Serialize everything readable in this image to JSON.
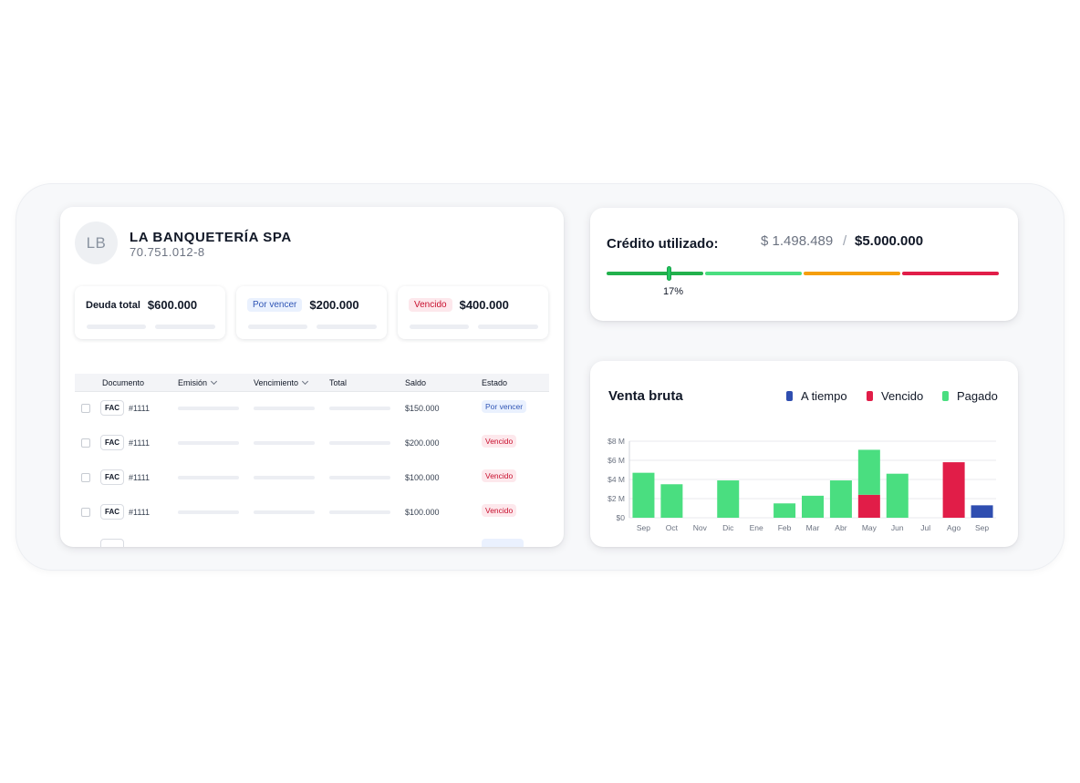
{
  "company": {
    "initials": "LB",
    "name": "LA BANQUETERÍA SPA",
    "rut": "70.751.012-8"
  },
  "stats": [
    {
      "label": "Deuda total",
      "value": "$600.000",
      "style": "plain"
    },
    {
      "label": "Por vencer",
      "value": "$200.000",
      "style": "blue"
    },
    {
      "label": "Vencido",
      "value": "$400.000",
      "style": "red"
    }
  ],
  "table": {
    "columns": [
      "Documento",
      "Emisión",
      "Vencimiento",
      "Total",
      "Saldo",
      "Estado"
    ],
    "rows": [
      {
        "type": "FAC",
        "number": "#1111",
        "saldo": "$150.000",
        "estado": "Por vencer",
        "estado_style": "blue"
      },
      {
        "type": "FAC",
        "number": "#1111",
        "saldo": "$200.000",
        "estado": "Vencido",
        "estado_style": "red"
      },
      {
        "type": "FAC",
        "number": "#1111",
        "saldo": "$100.000",
        "estado": "Vencido",
        "estado_style": "red"
      },
      {
        "type": "FAC",
        "number": "#1111",
        "saldo": "$100.000",
        "estado": "Vencido",
        "estado_style": "red"
      }
    ]
  },
  "credit": {
    "title": "Crédito utilizado:",
    "used": "$ 1.498.489",
    "separator": "/",
    "limit": "$5.000.000",
    "percent_label": "17%",
    "percent": 17,
    "segment_colors": [
      "#22b14c",
      "#4ade80",
      "#f59e0b",
      "#e11d48"
    ]
  },
  "chart_data": {
    "type": "bar",
    "title": "Venta bruta",
    "categories": [
      "Sep",
      "Oct",
      "Nov",
      "Dic",
      "Ene",
      "Feb",
      "Mar",
      "Abr",
      "May",
      "Jun",
      "Jul",
      "Ago",
      "Sep"
    ],
    "series": [
      {
        "name": "A tiempo",
        "color": "#2f4eb0",
        "values": [
          0,
          0,
          0,
          0,
          0,
          0,
          0,
          0,
          0,
          0,
          0,
          0,
          1.3
        ]
      },
      {
        "name": "Vencido",
        "color": "#e11d48",
        "values": [
          0,
          0,
          0,
          0,
          0,
          0,
          0,
          0,
          2.4,
          0,
          0,
          5.8,
          0
        ]
      },
      {
        "name": "Pagado",
        "color": "#4ade80",
        "values": [
          4.7,
          3.5,
          0,
          3.9,
          0,
          1.5,
          2.3,
          3.9,
          4.7,
          4.6,
          0,
          0,
          0
        ]
      }
    ],
    "stacked": true,
    "yticks": [
      "$0",
      "$2 M",
      "$4 M",
      "$6 M",
      "$8 M"
    ],
    "ylim": [
      0,
      8
    ],
    "grid": true,
    "legend_position": "top-right"
  }
}
